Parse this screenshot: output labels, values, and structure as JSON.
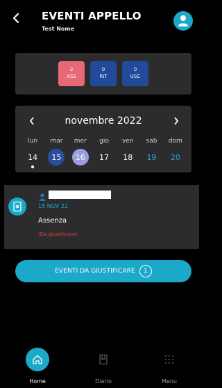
{
  "header": {
    "title": "EVENTI APPELLO",
    "subtitle": "Test Nome"
  },
  "stats": [
    {
      "value": "3",
      "label": "ASS",
      "color": "#e66a75"
    },
    {
      "value": "0",
      "label": "RIT",
      "color": "#214a9a"
    },
    {
      "value": "0",
      "label": "USC",
      "color": "#214a9a"
    }
  ],
  "calendar": {
    "month": "novembre 2022",
    "days": [
      "lun",
      "mar",
      "mer",
      "gio",
      "ven",
      "sab",
      "dom"
    ],
    "dates": [
      "14",
      "15",
      "16",
      "17",
      "18",
      "19",
      "20"
    ]
  },
  "event": {
    "date": "15 NOV 22",
    "type": "Assenza",
    "status": "(Da giustificare)"
  },
  "cta": {
    "label": "EVENTI DA GIUSTIFICARE",
    "count": "1"
  },
  "nav": {
    "home": "Home",
    "diario": "Diario",
    "menu": "Menu"
  },
  "colors": {
    "accent": "#1ca9c9",
    "absence": "#e66a75",
    "selected": "#2a4d9c",
    "today": "#9a9de0",
    "warning": "#e6433a"
  }
}
